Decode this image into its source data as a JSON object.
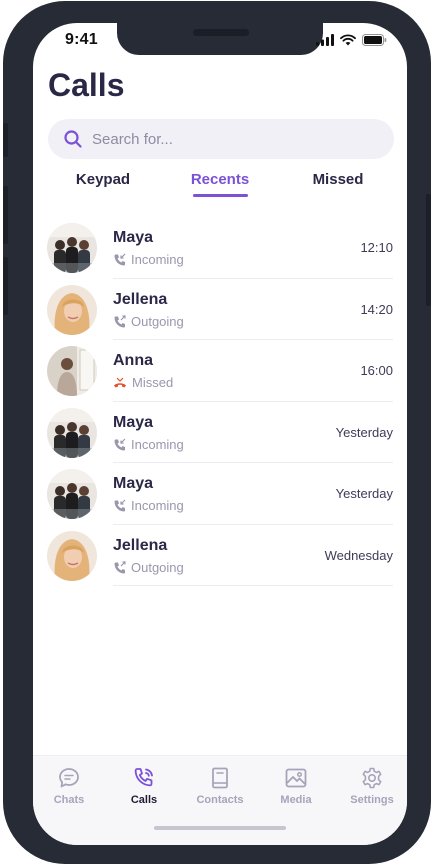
{
  "status_bar": {
    "time": "9:41"
  },
  "header": {
    "title": "Calls"
  },
  "search": {
    "placeholder": "Search for..."
  },
  "tabs": [
    {
      "label": "Keypad",
      "active": false
    },
    {
      "label": "Recents",
      "active": true
    },
    {
      "label": "Missed",
      "active": false
    }
  ],
  "calls": [
    {
      "name": "Maya",
      "type": "Incoming",
      "time": "12:10",
      "avatar": "avatar-group"
    },
    {
      "name": "Jellena",
      "type": "Outgoing",
      "time": "14:20",
      "avatar": "avatar-blonde"
    },
    {
      "name": "Anna",
      "type": "Missed",
      "time": "16:00",
      "avatar": "avatar-window"
    },
    {
      "name": "Maya",
      "type": "Incoming",
      "time": "Yesterday",
      "avatar": "avatar-group"
    },
    {
      "name": "Maya",
      "type": "Incoming",
      "time": "Yesterday",
      "avatar": "avatar-group"
    },
    {
      "name": "Jellena",
      "type": "Outgoing",
      "time": "Wednesday",
      "avatar": "avatar-blonde"
    }
  ],
  "nav": [
    {
      "label": "Chats",
      "icon": "chat-bubble-icon",
      "active": false
    },
    {
      "label": "Calls",
      "icon": "phone-icon",
      "active": true
    },
    {
      "label": "Contacts",
      "icon": "book-icon",
      "active": false
    },
    {
      "label": "Media",
      "icon": "image-icon",
      "active": false
    },
    {
      "label": "Settings",
      "icon": "gear-icon",
      "active": false
    }
  ],
  "colors": {
    "accent": "#7b52d6",
    "title": "#2b2847",
    "missed": "#e5502c",
    "frame": "#262b36"
  }
}
